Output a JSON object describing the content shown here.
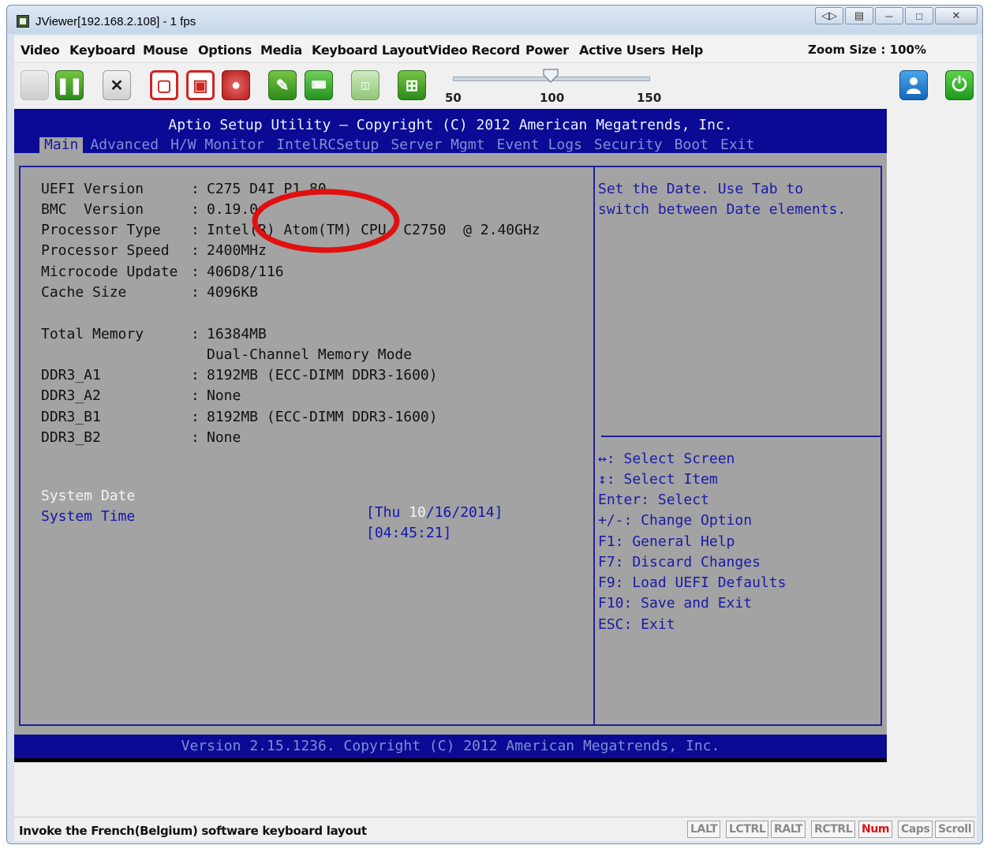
{
  "window": {
    "title": "JViewer[192.168.2.108] - 1 fps",
    "controls": [
      "◁▷",
      "▤",
      "─",
      "□",
      "✕"
    ]
  },
  "menu": {
    "items": [
      "Video",
      "Keyboard",
      "Mouse",
      "Options",
      "Media",
      "Keyboard Layout",
      "Video Record",
      "Power",
      "Active Users",
      "Help"
    ],
    "zoom": "Zoom Size : 100%"
  },
  "toolbar": {
    "buttons": [
      "blank",
      "pause-icon",
      "fullscreen-toggle-icon",
      "cd-icon",
      "floppy-icon",
      "hard-disk-icon",
      "mouse-icon",
      "keyboard-icon",
      "cd-media-icon",
      "soft-keyboard-icon",
      "user-icon",
      "power-icon"
    ],
    "slider": {
      "ticks": [
        "50",
        "100",
        "150"
      ],
      "value": 100
    }
  },
  "bios": {
    "title": "Aptio Setup Utility – Copyright (C) 2012 American Megatrends, Inc.",
    "tabs": [
      "Main",
      "Advanced",
      "H/W Monitor",
      "IntelRCSetup",
      "Server Mgmt",
      "Event Logs",
      "Security",
      "Boot",
      "Exit"
    ],
    "active_tab": "Main",
    "info": [
      {
        "label": "UEFI Version",
        "colon": ":",
        "value": "C275 D4I P1.80"
      },
      {
        "label": "BMC  Version",
        "colon": ":",
        "value": "0.19.0"
      },
      {
        "label": "Processor Type",
        "colon": ":",
        "value": "Intel(R) Atom(TM) CPU  C2750  @ 2.40GHz"
      },
      {
        "label": "Processor Speed",
        "colon": ":",
        "value": "2400MHz"
      },
      {
        "label": "Microcode Update",
        "colon": ":",
        "value": "406D8/116"
      },
      {
        "label": "Cache Size",
        "colon": ":",
        "value": "4096KB"
      }
    ],
    "memory": [
      {
        "label": "Total Memory",
        "colon": ":",
        "value": "16384MB"
      },
      {
        "label": "",
        "colon": "",
        "value": "Dual-Channel Memory Mode"
      },
      {
        "label": "DDR3_A1",
        "colon": ":",
        "value": "8192MB (ECC-DIMM DDR3-1600)"
      },
      {
        "label": "DDR3_A2",
        "colon": ":",
        "value": "None"
      },
      {
        "label": "DDR3_B1",
        "colon": ":",
        "value": "8192MB (ECC-DIMM DDR3-1600)"
      },
      {
        "label": "DDR3_B2",
        "colon": ":",
        "value": "None"
      }
    ],
    "system_date": {
      "label": "System Date",
      "value_prefix": "[Thu ",
      "value_highlight": "10",
      "value_suffix": "/16/2014]"
    },
    "system_time": {
      "label": "System Time",
      "value": "[04:45:21]"
    },
    "help": [
      "Set the Date. Use Tab to",
      "switch between Date elements."
    ],
    "keys": [
      "↔: Select Screen",
      "↕: Select Item",
      "Enter: Select",
      "+/-: Change Option",
      "F1: General Help",
      "F7: Discard Changes",
      "F9: Load UEFI Defaults",
      "F10: Save and Exit",
      "ESC: Exit"
    ],
    "footer": "Version 2.15.1236. Copyright (C) 2012 American Megatrends, Inc."
  },
  "status": {
    "message": "Invoke the French(Belgium) software keyboard layout",
    "locks": [
      "LALT",
      "LCTRL",
      "RALT",
      "RCTRL",
      "Num",
      "Caps",
      "Scroll"
    ],
    "active_lock": "Num"
  },
  "colors": {
    "bios_blue": "#0a0a94",
    "bios_gray": "#a3a3a3",
    "annotation_red": "#e01010"
  }
}
